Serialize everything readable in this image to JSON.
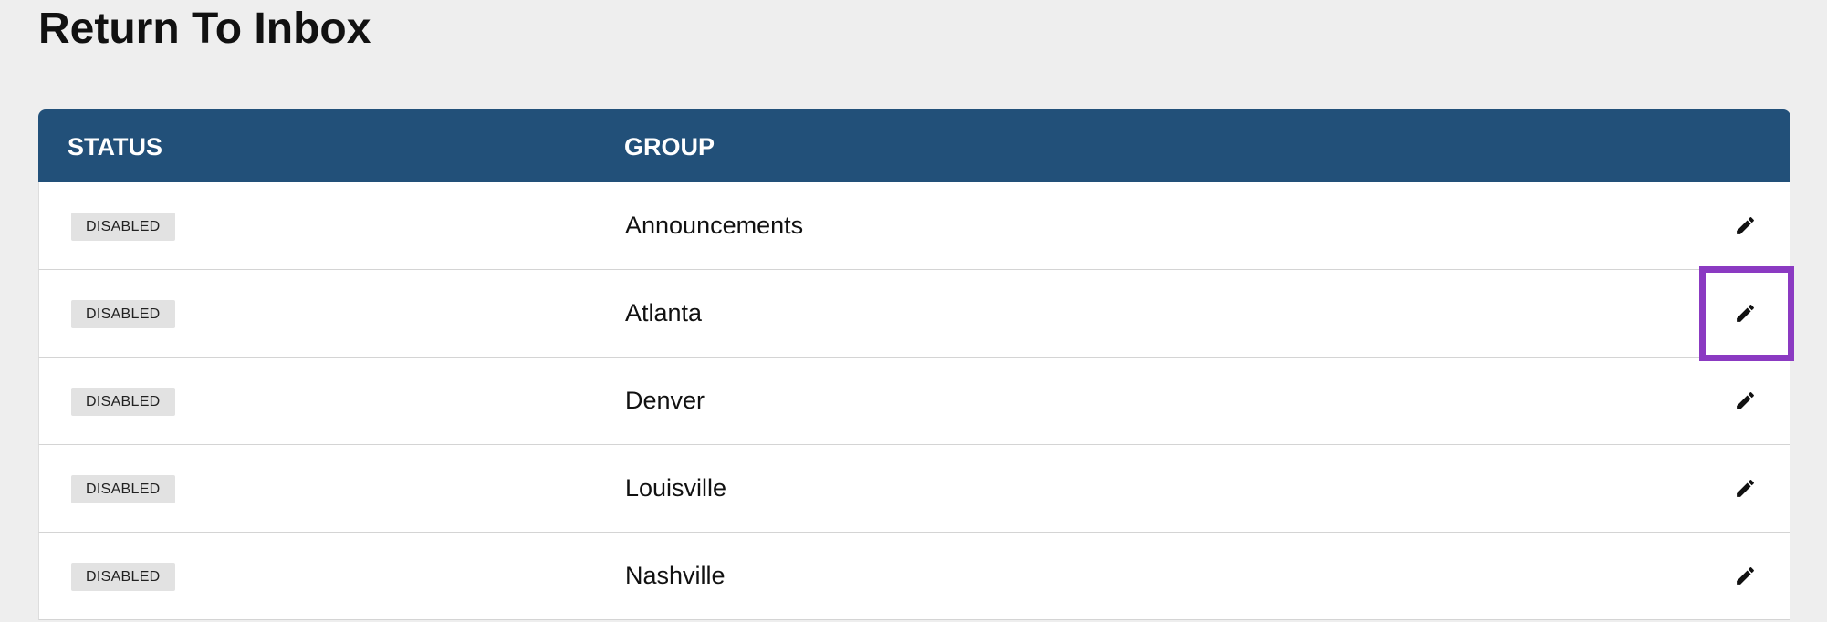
{
  "page": {
    "title": "Return To Inbox"
  },
  "table": {
    "headers": {
      "status": "STATUS",
      "group": "GROUP"
    },
    "rows": [
      {
        "status": "DISABLED",
        "group": "Announcements",
        "edit_icon": "pencil-icon"
      },
      {
        "status": "DISABLED",
        "group": "Atlanta",
        "edit_icon": "pencil-icon"
      },
      {
        "status": "DISABLED",
        "group": "Denver",
        "edit_icon": "pencil-icon"
      },
      {
        "status": "DISABLED",
        "group": "Louisville",
        "edit_icon": "pencil-icon"
      },
      {
        "status": "DISABLED",
        "group": "Nashville",
        "edit_icon": "pencil-icon"
      }
    ]
  },
  "colors": {
    "header_bg": "#225079",
    "highlight": "#8b3ac2",
    "badge_bg": "#e2e2e2",
    "page_bg": "#eeeeee"
  }
}
